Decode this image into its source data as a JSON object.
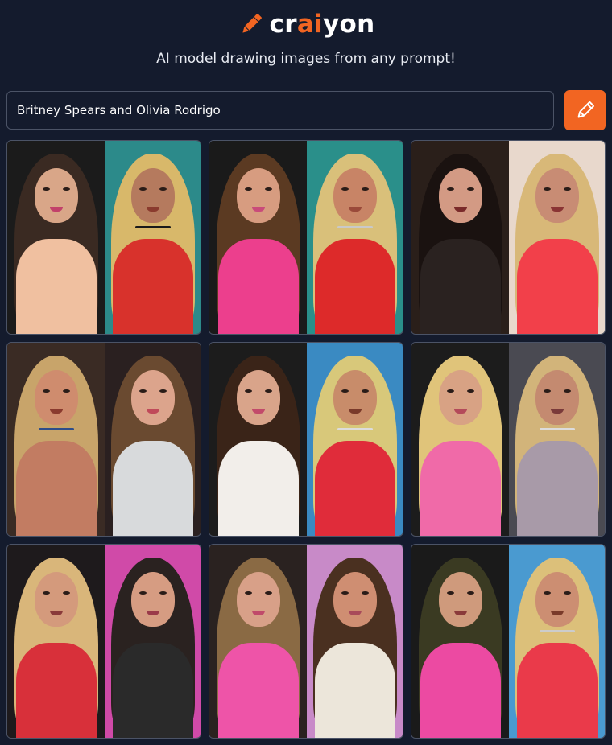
{
  "header": {
    "brand_prefix": "cr",
    "brand_accent": "ai",
    "brand_suffix": "yon",
    "tagline": "AI model drawing images from any prompt!",
    "logo_icon": "pencil-icon"
  },
  "prompt": {
    "value": "Britney Spears and Olivia Rodrigo",
    "button_icon": "pencil-icon"
  },
  "colors": {
    "background": "#141b2d",
    "accent": "#f26522",
    "border": "#4b5366"
  },
  "results": [
    {
      "left": {
        "bg": "#1b1b1b",
        "hair": "#3a2a22",
        "skin": "#d9a688",
        "body": "#f0c0a0",
        "mouth": "#c2416a"
      },
      "right": {
        "bg": "#2c8a8a",
        "hair": "#d8b86a",
        "skin": "#b57a5e",
        "body": "#d8322c",
        "mouth": "#8a3b2e",
        "necklace": "#1a1a1a"
      }
    },
    {
      "left": {
        "bg": "#1a1a1a",
        "hair": "#5b3a22",
        "skin": "#d79c80",
        "body": "#ec3f8d",
        "mouth": "#c94b7a"
      },
      "right": {
        "bg": "#2a8f8a",
        "hair": "#d9c07a",
        "skin": "#c88466",
        "body": "#dd2a2a",
        "mouth": "#9a4a3a",
        "necklace": "#c9c9c9"
      }
    },
    {
      "left": {
        "bg": "#2a1f1a",
        "hair": "#1a1210",
        "skin": "#d39a84",
        "body": "#2a2220",
        "mouth": "#7a2a2a"
      },
      "right": {
        "bg": "#e8d8cc",
        "hair": "#d8b878",
        "skin": "#c88c74",
        "body": "#f2404a",
        "mouth": "#8a3434"
      }
    },
    {
      "left": {
        "bg": "#3a2b24",
        "hair": "#c8a46a",
        "skin": "#cf8c6e",
        "body": "#c27c62",
        "mouth": "#8a3a2e",
        "necklace": "#2e4d8a"
      },
      "right": {
        "bg": "#2a2020",
        "hair": "#6a4a30",
        "skin": "#dca48c",
        "body": "#d8dadc",
        "mouth": "#c04a5a"
      }
    },
    {
      "left": {
        "bg": "#1c1c1c",
        "hair": "#3a2418",
        "skin": "#d9a48a",
        "body": "#f2eeea",
        "mouth": "#c24a6a"
      },
      "right": {
        "bg": "#3a8ac2",
        "hair": "#d8c87a",
        "skin": "#c88c6a",
        "body": "#e02c3a",
        "mouth": "#7a3a2a",
        "necklace": "#dcdcdc"
      }
    },
    {
      "left": {
        "bg": "#1c1c1c",
        "hair": "#e0c47a",
        "skin": "#d8a284",
        "body": "#f06aa8",
        "mouth": "#b44a5a"
      },
      "right": {
        "bg": "#4a4a52",
        "hair": "#d2b47a",
        "skin": "#c48a70",
        "body": "#a89aa8",
        "mouth": "#7a3a3a",
        "necklace": "#dcdcdc"
      }
    },
    {
      "left": {
        "bg": "#1e1a1c",
        "hair": "#d9b67a",
        "skin": "#d49a7c",
        "body": "#d8303a",
        "mouth": "#8a3a3a"
      },
      "right": {
        "bg": "#d04aa8",
        "hair": "#2a2220",
        "skin": "#d69c82",
        "body": "#2a2a2a",
        "mouth": "#9a3a4a"
      }
    },
    {
      "left": {
        "bg": "#2a2220",
        "hair": "#8a6a44",
        "skin": "#d8a088",
        "body": "#ee54a8",
        "mouth": "#c04a6a"
      },
      "right": {
        "bg": "#c88ac8",
        "hair": "#4a3020",
        "skin": "#cf8e72",
        "body": "#ece6da",
        "mouth": "#a84a5a"
      }
    },
    {
      "left": {
        "bg": "#1a1a1a",
        "hair": "#3a3a22",
        "skin": "#cf9a7c",
        "body": "#ec4aa2",
        "mouth": "#8a3a3a"
      },
      "right": {
        "bg": "#4a9ad0",
        "hair": "#dcc07a",
        "skin": "#cc8e72",
        "body": "#ea3a4a",
        "mouth": "#7a3a2a",
        "necklace": "#cccccc"
      }
    }
  ]
}
